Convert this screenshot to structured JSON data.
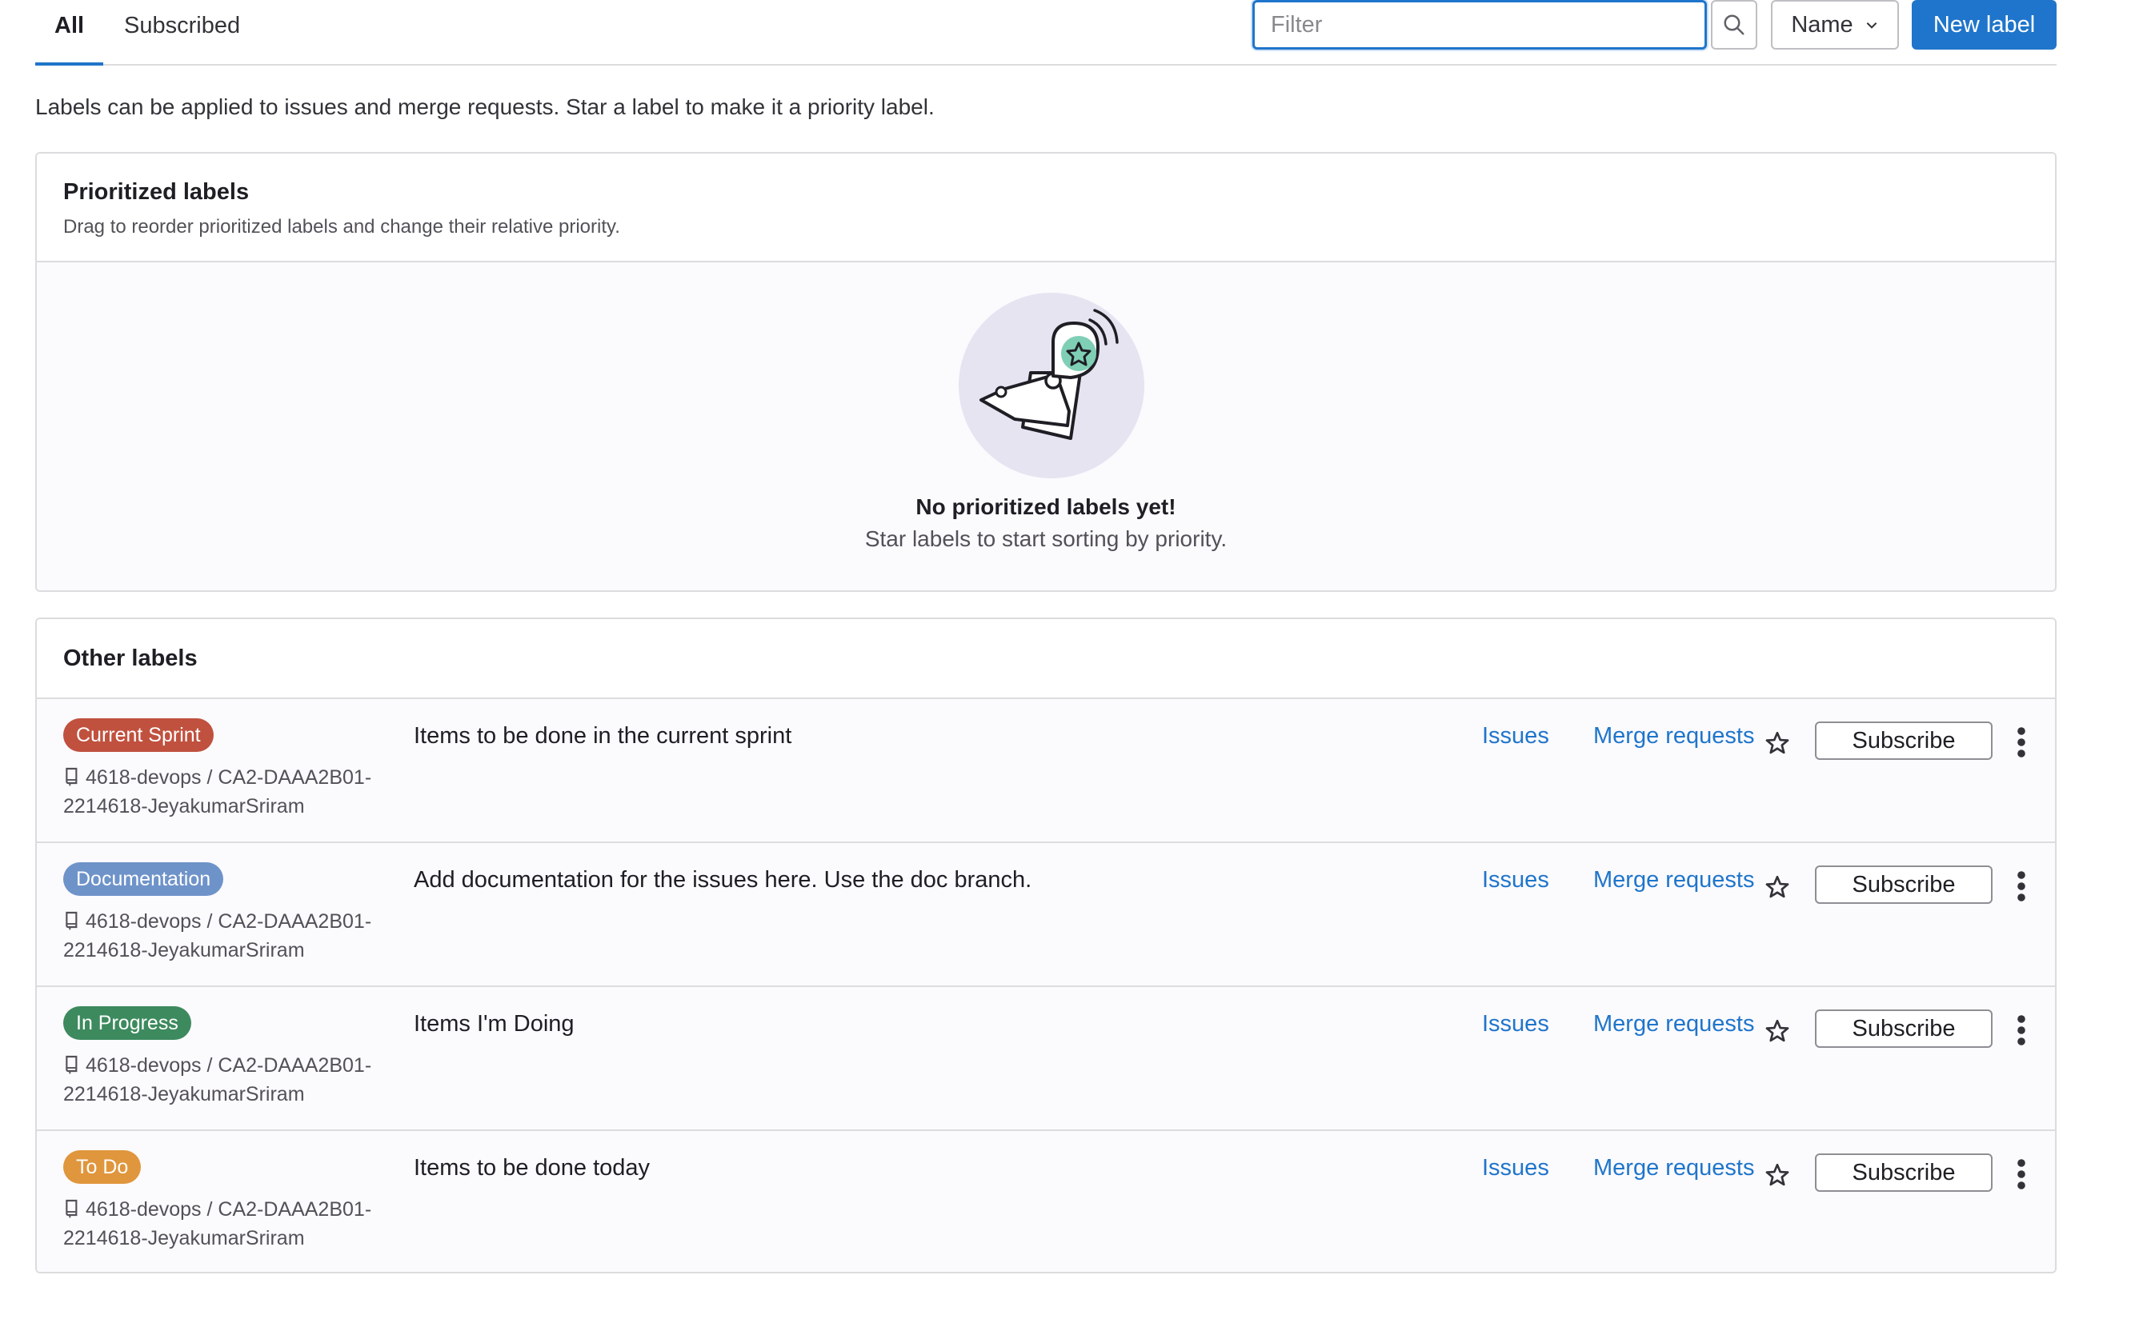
{
  "tabs": {
    "all": "All",
    "subscribed": "Subscribed"
  },
  "toolbar": {
    "filter_placeholder": "Filter",
    "filter_value": "",
    "sort_label": "Name",
    "new_label_button": "New label"
  },
  "intro_text": "Labels can be applied to issues and merge requests. Star a label to make it a priority label.",
  "prioritized": {
    "title": "Prioritized labels",
    "description": "Drag to reorder prioritized labels and change their relative priority.",
    "empty_title": "No prioritized labels yet!",
    "empty_subtitle": "Star labels to start sorting by priority."
  },
  "other": {
    "title": "Other labels",
    "labels": [
      {
        "name": "Current Sprint",
        "color": "#c0513f",
        "path_line1": "4618-devops / CA2-DAAA2B01-",
        "path_line2": "2214618-JeyakumarSriram",
        "description": "Items to be done in the current sprint",
        "issues": "Issues",
        "merge_requests": "Merge requests",
        "subscribe": "Subscribe"
      },
      {
        "name": "Documentation",
        "color": "#6e93c9",
        "path_line1": "4618-devops / CA2-DAAA2B01-",
        "path_line2": "2214618-JeyakumarSriram",
        "description": "Add documentation for the issues here. Use the doc branch.",
        "issues": "Issues",
        "merge_requests": "Merge requests",
        "subscribe": "Subscribe"
      },
      {
        "name": "In Progress",
        "color": "#3d8a5e",
        "path_line1": "4618-devops / CA2-DAAA2B01-",
        "path_line2": "2214618-JeyakumarSriram",
        "description": "Items I'm Doing",
        "issues": "Issues",
        "merge_requests": "Merge requests",
        "subscribe": "Subscribe"
      },
      {
        "name": "To Do",
        "color": "#e0963c",
        "path_line1": "4618-devops / CA2-DAAA2B01-",
        "path_line2": "2214618-JeyakumarSriram",
        "description": "Items to be done today",
        "issues": "Issues",
        "merge_requests": "Merge requests",
        "subscribe": "Subscribe"
      }
    ]
  },
  "icons": {
    "search": "search-icon",
    "sort_chevron": "chevron-down-icon",
    "repo": "project-icon",
    "star": "star-icon",
    "more": "more-vertical-icon",
    "empty_state": "label-star-illustration"
  },
  "colors": {
    "accent": "#1f75cb"
  }
}
